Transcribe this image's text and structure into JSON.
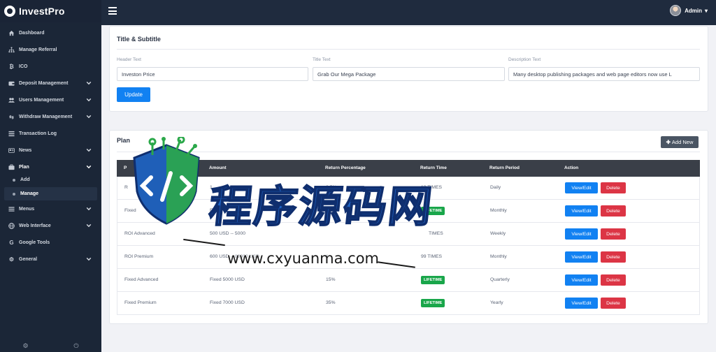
{
  "brand": {
    "name": "InvestPro"
  },
  "topbar": {
    "admin_label": "Admin"
  },
  "sidebar": {
    "items": [
      {
        "label": "Dashboard",
        "icon": "home-icon"
      },
      {
        "label": "Manage Referral",
        "icon": "sitemap-icon"
      },
      {
        "label": "ICO",
        "icon": "bitcoin-icon"
      },
      {
        "label": "Deposit Management",
        "icon": "wallet-icon"
      },
      {
        "label": "Users Management",
        "icon": "users-icon"
      },
      {
        "label": "Withdraw Management",
        "icon": "exchange-icon"
      },
      {
        "label": "Transaction Log",
        "icon": "list-icon"
      },
      {
        "label": "News",
        "icon": "newspaper-icon"
      },
      {
        "label": "Plan",
        "icon": "briefcase-icon"
      },
      {
        "label": "Menus",
        "icon": "bars-icon"
      },
      {
        "label": "Web Interface",
        "icon": "globe-icon"
      },
      {
        "label": "Google Tools",
        "icon": "google-icon"
      },
      {
        "label": "General",
        "icon": "gear-icon"
      }
    ],
    "plan_sub": [
      "Add",
      "Manage"
    ]
  },
  "title_section": {
    "title": "Title & Subtitle",
    "header_label": "Header Text",
    "header_value": "Investon Price",
    "title_label": "Title Text",
    "title_value": "Grab Our Mega Package",
    "description_label": "Description Text",
    "description_value": "Many desktop publishing packages and web page editors now use L",
    "update_button": "Update"
  },
  "plan_section": {
    "title": "Plan",
    "add_button": "Add New",
    "columns": [
      "P",
      "Amount",
      "Return Percentage",
      "Return Time",
      "Return Period",
      "Action"
    ],
    "view_label": "View/Edit",
    "delete_label": "Delete",
    "rows": [
      {
        "name": "R",
        "amount": "1",
        "percent": "2.5%",
        "time": "10 TIMES",
        "period": "Daily"
      },
      {
        "name": "Fixed",
        "amount": "F",
        "percent": "",
        "time": "LIFETIME",
        "period": "Monthly"
      },
      {
        "name": "ROI Advanced",
        "amount": "500 USD -- 5000",
        "percent": "",
        "time": "TIMES",
        "period": "Weekly"
      },
      {
        "name": "ROI Premium",
        "amount": "600 USD -- 80000 USD",
        "percent": "1",
        "time": "99 TIMES",
        "period": "Monthly"
      },
      {
        "name": "Fixed Advanced",
        "amount": "Fixed 5000 USD",
        "percent": "15%",
        "time": "LIFETIME",
        "period": "Quarterly"
      },
      {
        "name": "Fixed Premium",
        "amount": "Fixed 7000 USD",
        "percent": "35%",
        "time": "LIFETIME",
        "period": "Yearly"
      }
    ]
  },
  "watermark": {
    "big": "程序源码网",
    "url": "www.cxyuanma.com"
  },
  "colors": {
    "primary": "#1181f2",
    "danger": "#dc3545",
    "success": "#19a64a",
    "sidebar": "#1b2637"
  }
}
